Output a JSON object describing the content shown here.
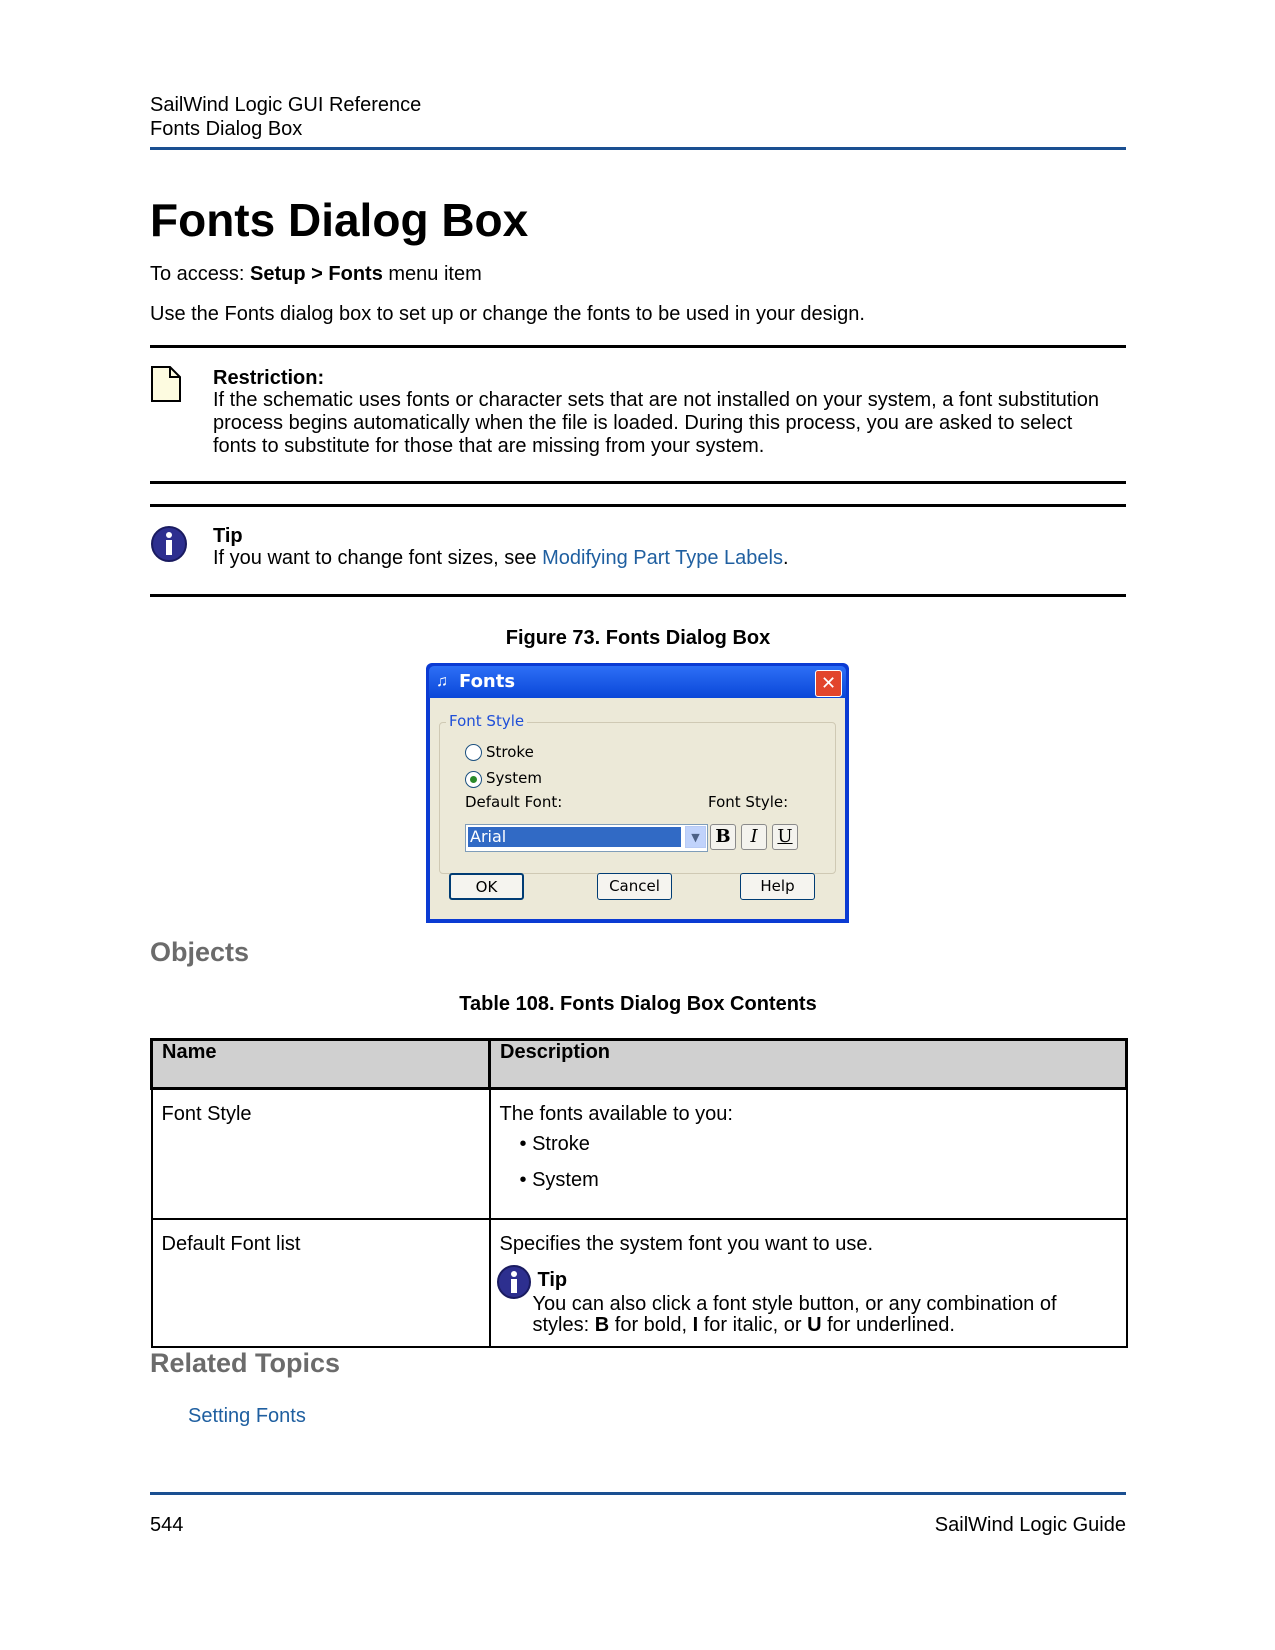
{
  "header": {
    "doc_title": "SailWind Logic GUI Reference",
    "section": "Fonts Dialog Box"
  },
  "page_title": "Fonts Dialog Box",
  "access": {
    "prefix": "To access: ",
    "path": "Setup > Fonts",
    "suffix": " menu item"
  },
  "intro": "Use the Fonts dialog box to set up or change the fonts to be used in your design.",
  "restriction": {
    "heading": "Restriction:",
    "body": "If the schematic uses fonts or character sets that are not installed on your system, a font substitution process begins automatically when the file is loaded. During this process, you are asked to select fonts to substitute for those that are missing from your system."
  },
  "tip": {
    "heading": "Tip",
    "prefix": "If you want to change font sizes, see ",
    "link": "Modifying Part Type Labels",
    "suffix": "."
  },
  "figure_caption": "Figure 73. Fonts Dialog Box",
  "dialog": {
    "title": "Fonts",
    "close_symbol": "✕",
    "group_label": "Font Style",
    "option_stroke": "Stroke",
    "option_system": "System",
    "selected_option": "System",
    "default_font_label": "Default Font:",
    "font_style_label": "Font Style:",
    "default_font_value": "Arial",
    "bold_label": "B",
    "italic_label": "I",
    "underline_label": "U",
    "ok_label": "OK",
    "cancel_label": "Cancel",
    "help_label": "Help"
  },
  "objects_heading": "Objects",
  "table_caption": "Table 108. Fonts Dialog Box Contents",
  "table": {
    "headers": [
      "Name",
      "Description"
    ],
    "rows": [
      {
        "name": "Font Style",
        "description": "The fonts available to you:",
        "bullets": [
          "Stroke",
          "System"
        ]
      },
      {
        "name": "Default Font list",
        "description": "Specifies the system font you want to use.",
        "tip_heading": "Tip",
        "tip_prefix": "You can also click a font style button, or any combination of styles: ",
        "tip_b": "B",
        "tip_mid1": " for bold, ",
        "tip_i": "I",
        "tip_mid2": " for italic, or ",
        "tip_u": "U",
        "tip_suffix": " for underlined."
      }
    ]
  },
  "related_heading": "Related Topics",
  "related_link": "Setting Fonts",
  "footer": {
    "page_number": "544",
    "guide_name": "SailWind Logic Guide"
  },
  "colors": {
    "rule_blue": "#1a4f91",
    "link": "#1f5fa0",
    "section_heading": "#6b6b6b"
  }
}
